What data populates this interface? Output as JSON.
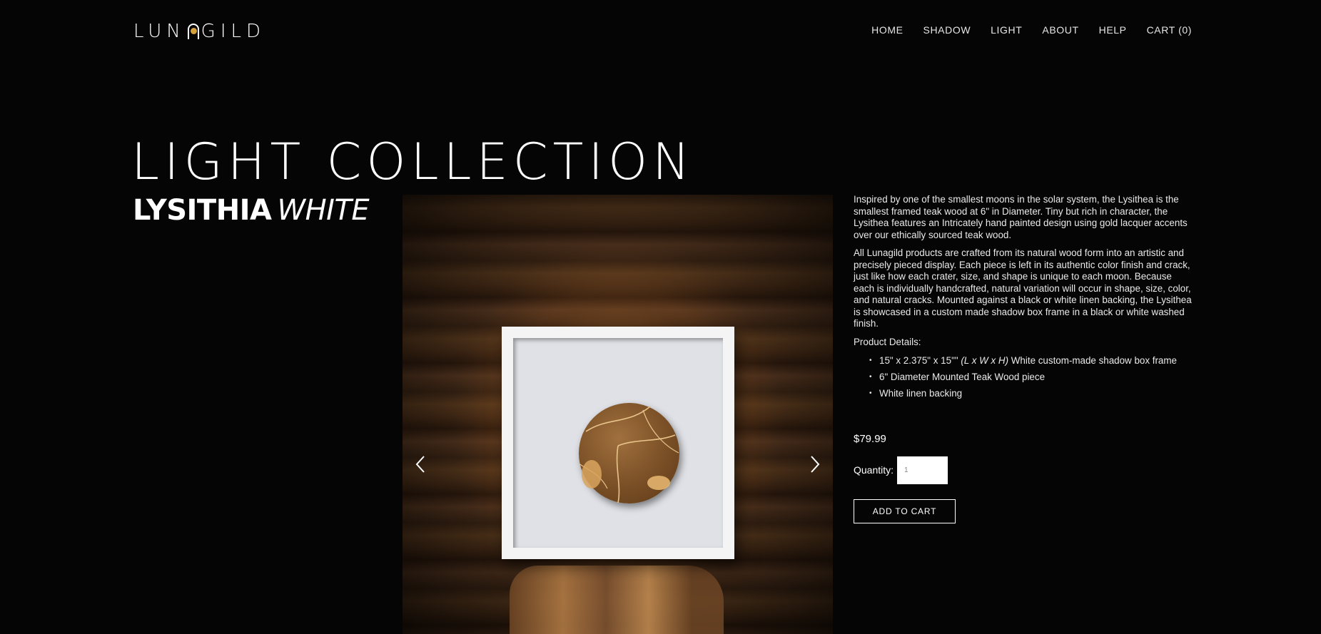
{
  "header": {
    "logo_text_left": "LUN",
    "logo_text_right": "GILD",
    "nav": [
      "HOME",
      "SHADOW",
      "LIGHT",
      "ABOUT",
      "HELP",
      "CART (0)"
    ]
  },
  "collection_title": "LIGHT COLLECTION",
  "product": {
    "name_bold": "LYSITHIA",
    "name_italic": "WHITE",
    "description_1": "Inspired by one of the smallest moons in the solar system, the Lysithea is the smallest framed teak wood at 6\" in Diameter. Tiny but rich in character, the Lysithea features an Intricately hand painted design using gold lacquer accents over our ethically sourced teak wood.",
    "description_2": "All Lunagild products are crafted from its natural wood form into an artistic and precisely pieced display. Each piece is left in its authentic color finish and crack, just like how each crater, size, and shape is unique to each moon. Because each is individually handcrafted, natural variation will occur in shape, size, color, and natural cracks. Mounted against a black or white linen backing, the Lysithea is showcased in a custom made shadow box frame in a black or white washed finish.",
    "details_label": "Product Details:",
    "detail_1_dims": "15\" x 2.375\" x 15\"\"",
    "detail_1_lwh": "(L x W x H)",
    "detail_1_rest": "White custom-made shadow box frame",
    "detail_2": "6\" Diameter Mounted Teak Wood piece",
    "detail_3": "White linen backing",
    "price": "$79.99",
    "quantity_label": "Quantity:",
    "quantity_value": "1",
    "add_to_cart": "ADD TO CART"
  },
  "icons": {
    "prev": "chevron-left-icon",
    "next": "chevron-right-icon"
  },
  "colors": {
    "background": "#050505",
    "text": "#ffffff",
    "gold_accent": "#d8a23a"
  }
}
